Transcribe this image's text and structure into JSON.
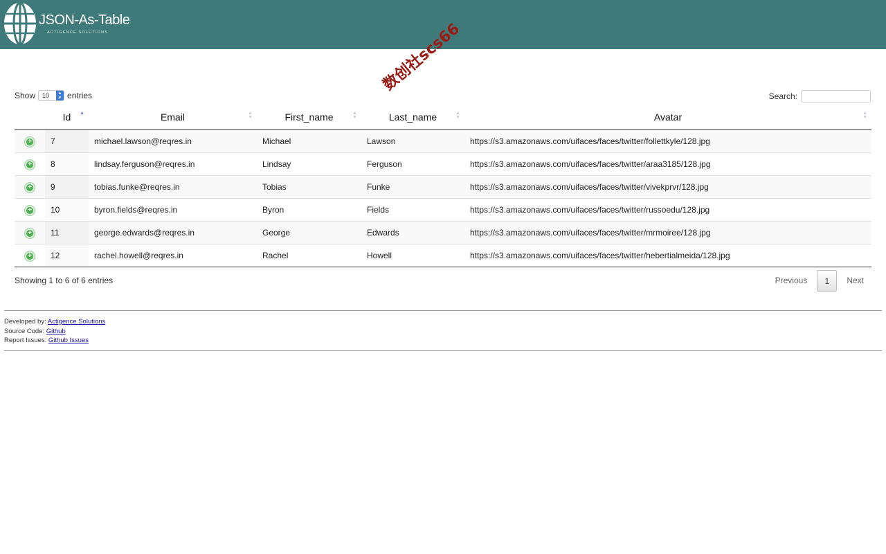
{
  "header": {
    "title": "JSON-As-Table",
    "subtitle": "ACTIGENCE SOLUTIONS",
    "logo_icon": "globe-icon",
    "background": "#3f7a7b"
  },
  "watermark": "数创社scs66",
  "controls": {
    "show_label": "Show",
    "page_length": "10",
    "entries_label": "entries",
    "search_label": "Search:",
    "search_value": ""
  },
  "table": {
    "columns": [
      "",
      "Id",
      "Email",
      "First_name",
      "Last_name",
      "Avatar"
    ],
    "rows": [
      [
        "7",
        "michael.lawson@reqres.in",
        "Michael",
        "Lawson",
        "https://s3.amazonaws.com/uifaces/faces/twitter/follettkyle/128.jpg"
      ],
      [
        "8",
        "lindsay.ferguson@reqres.in",
        "Lindsay",
        "Ferguson",
        "https://s3.amazonaws.com/uifaces/faces/twitter/araa3185/128.jpg"
      ],
      [
        "9",
        "tobias.funke@reqres.in",
        "Tobias",
        "Funke",
        "https://s3.amazonaws.com/uifaces/faces/twitter/vivekprvr/128.jpg"
      ],
      [
        "10",
        "byron.fields@reqres.in",
        "Byron",
        "Fields",
        "https://s3.amazonaws.com/uifaces/faces/twitter/russoedu/128.jpg"
      ],
      [
        "11",
        "george.edwards@reqres.in",
        "George",
        "Edwards",
        "https://s3.amazonaws.com/uifaces/faces/twitter/mrmoiree/128.jpg"
      ],
      [
        "12",
        "rachel.howell@reqres.in",
        "Rachel",
        "Howell",
        "https://s3.amazonaws.com/uifaces/faces/twitter/hebertialmeida/128.jpg"
      ]
    ],
    "expand_icon": "plus-circle-icon",
    "sorted_column": "Id"
  },
  "pagination": {
    "info": "Showing 1 to 6 of 6 entries",
    "previous": "Previous",
    "current": "1",
    "next": "Next"
  },
  "footer": {
    "developed_label": "Developed by:",
    "developed_link": "Actigence Solutions",
    "source_label": "Source Code:",
    "source_link": "Github",
    "issues_label": "Report Issues:",
    "issues_link": "Github Issues"
  }
}
